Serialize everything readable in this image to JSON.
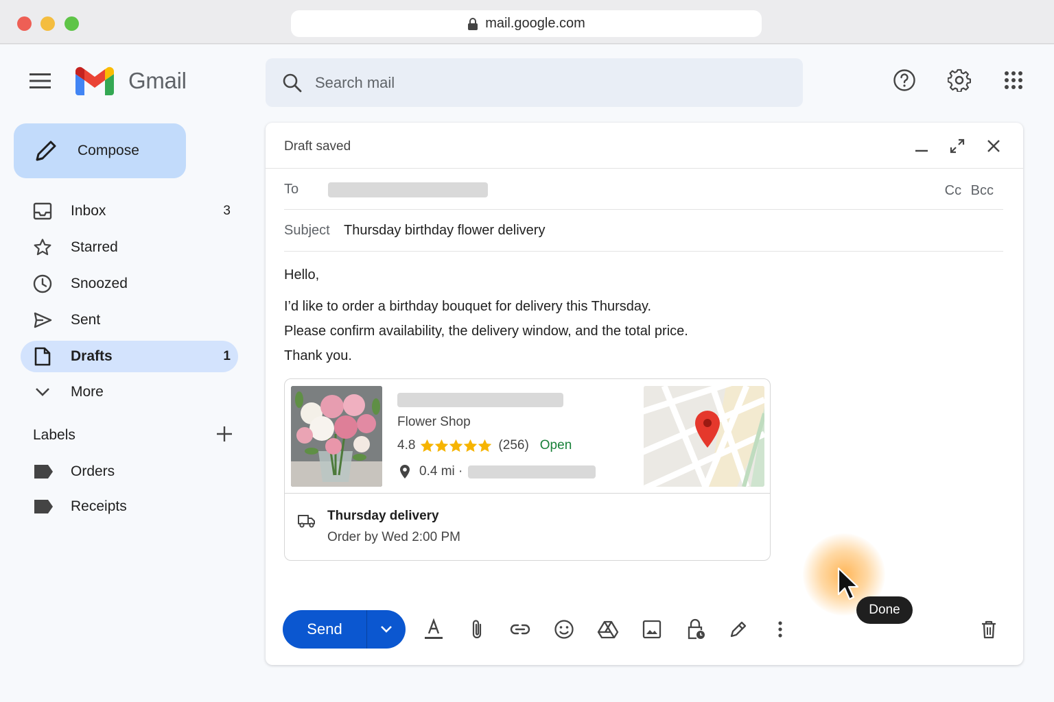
{
  "browser": {
    "url": "mail.google.com"
  },
  "header": {
    "app_name": "Gmail",
    "search_placeholder": "Search mail"
  },
  "sidebar": {
    "compose_label": "Compose",
    "items": [
      {
        "label": "Inbox",
        "count": "3",
        "icon": "inbox-icon"
      },
      {
        "label": "Starred",
        "count": "",
        "icon": "star-icon"
      },
      {
        "label": "Snoozed",
        "count": "",
        "icon": "clock-icon"
      },
      {
        "label": "Sent",
        "count": "",
        "icon": "send-icon"
      },
      {
        "label": "Drafts",
        "count": "1",
        "icon": "draft-icon",
        "active": true
      },
      {
        "label": "More",
        "count": "",
        "icon": "chevron-down-icon"
      }
    ],
    "labels_heading": "Labels",
    "labels": [
      {
        "label": "Orders"
      },
      {
        "label": "Receipts"
      }
    ]
  },
  "compose": {
    "status": "Draft saved",
    "to_label": "To",
    "cc_bcc": "Cc Bcc",
    "subject_label": "Subject",
    "subject": "Thursday birthday flower delivery",
    "body": [
      "Hello,",
      "I’d like to order a birthday bouquet for delivery this Thursday.",
      "Please confirm availability, the delivery window, and the total price.",
      "Thank you."
    ],
    "place_card": {
      "category": "Flower Shop",
      "rating": "4.8",
      "rating_value": 4.8,
      "reviews": "(256)",
      "status": "Open",
      "distance": "0.4 mi ·",
      "delivery_title": "Thursday delivery",
      "delivery_sub": "Order by Wed 2:00 PM"
    },
    "send_label": "Send"
  },
  "tooltip": "Done",
  "colors": {
    "accent": "#0b57d0",
    "active_nav": "#d3e3fd",
    "compose_btn": "#c2dbfb",
    "open_green": "#188038",
    "star": "#f6b400"
  }
}
